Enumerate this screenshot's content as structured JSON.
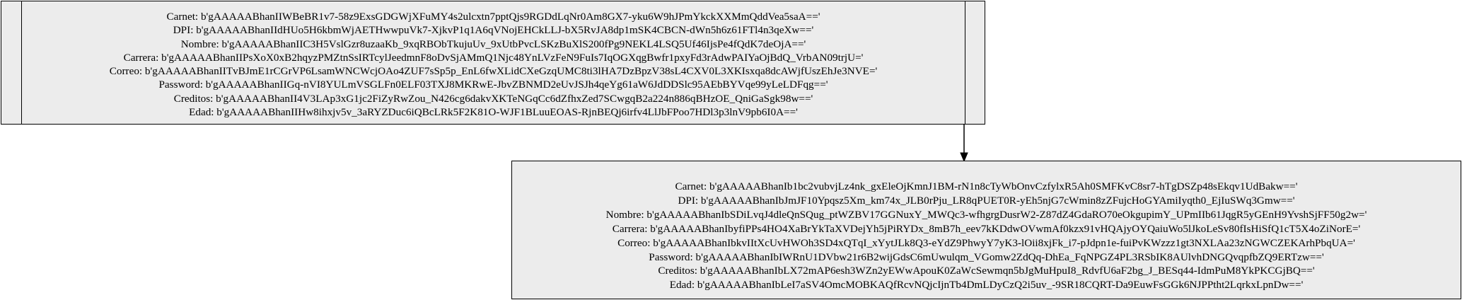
{
  "nodes": [
    {
      "fields": [
        "Carnet: b'gAAAAABhanIIWBeBR1v7-58z9ExsGDGWjXFuMY4s2ulcxtn7pptQjs9RGDdLqNr0Am8GX7-yku6W9hJPmYkckXXMmQddVea5saA=='",
        "DPI: b'gAAAAABhanIIdHUo5H6kbmWjAETHwwpuVk7-XjkvP1q1A6qVNojEHCkLLJ-bX5RvJA8dp1mSK4CBCN-dWn5h6z61FTl4n3qeXw=='",
        "Nombre: b'gAAAAABhanIIC3H5VslGzr8uzaaKb_9xqRBObTkujuUv_9xUtbPvcLSKzBuXlS200fPg9NEKL4LSQ5Uf46IjsPe4fQdK7deOjA=='",
        "Carrera: b'gAAAAABhanIIPsXoX0xB2hqyzPMZtnSsIRTcylJeedmnF8oDvSjAMmQ1Njc48YnLVzFeN9FuIs7IqOGXqgBwfr1pxyFd3rAdwPAIYaOjBdQ_VrbAN09trjU='",
        "Correo: b'gAAAAABhanIITvBJmE1rCGrVP6LsamWNCWcjOAo4ZUF7sSp5p_EnL6fwXLidCXeGzqUMC8ti3lHA7DzBpzV38sL4CXV0L3XKIsxqa8dcAWjfUszEhJe3NVE='",
        "Password: b'gAAAAABhanIIGq-nVI8YULmVSGLFn0ELF03TXJ8MKRwE-JbvZBNMD2eUvJSJh4qeYg61aW6JdDDSlc95AEbBYVqe99yLeLDFqg=='",
        "Creditos: b'gAAAAABhanII4V3LAp3xG1jc2FiZyRwZou_N426cg6dakvXKTeNGqCc6dZfhxZed7SCwgqB2a224n886qBHzOE_QniGaSgk98w=='",
        "Edad: b'gAAAAABhanIIHw8ihxjv5v_3aRYZDuc6iQBcLRk5F2K81O-WJF1BLuuEOAS-RjnBEQj6irfv4LlJbFPoo7HDl3p3lnV9pb6I0A=='"
      ]
    },
    {
      "fields": [
        "Carnet: b'gAAAAABhanIb1bc2vubvjLz4nk_gxEleOjKmnJ1BM-rN1n8cTyWbOnvCzfylxR5Ah0SMFKvC8sr7-hTgDSZp48sEkqv1UdBakw=='",
        "DPI: b'gAAAAABhanIbJmJF10Ypqsz5Xm_km74x_JLB0rPju_LR8qPUET0R-yEh5njG7cWmin8zZFujcHoGYAmiIyqth0_EjIuSWq3Gmw=='",
        "Nombre: b'gAAAAABhanIbSDiLvqJ4dleQnSQug_ptWZBV17GGNuxY_MWQc3-wfhgrgDusrW2-Z87dZ4GdaRO70eOkgupimY_UPmIIb61JqgR5yGEnH9YvshSjFF50g2w='",
        "Carrera: b'gAAAAABhanIbyfiPPs4HO4XaBrYkTaXVDejYh5jPiRYDx_8mB7h_eev7kKDdwOVwmAf0kzx91vHQAjyOYQaiuWo5lJkoLeSv80fIsHiSfQ1cT5X4oZiNorE='",
        "Correo: b'gAAAAABhanIbkvIItXcUvHWOh3SD4xQTqI_xYytJLk8Q3-eYdZ9PhwyY7yK3-lOii8xjFk_i7-pJdpn1e-fuiPvKWzzz1gt3NXLAa23zNGWCZEKArhPbqUA='",
        "Password: b'gAAAAABhanIbIWRnU1DVbw21r6B2wijGdsC6mUwulqm_VGomw2ZdQq-DhEa_FqNPGZ4PL3RSbIK8AUlvhDNGQvqpfbZQ9ERTzw=='",
        "Creditos: b'gAAAAABhanIbLX72mAP6esh3WZn2yEWwApouK0ZaWcSewmqn5bJgMuHpuI8_RdvfU6aF2bg_J_BESq44-IdmPuM8YkPKCGjBQ=='",
        "Edad: b'gAAAAABhanIbLeI7aSV4OmcMOBKAQfRcvNQjcIjnTb4DmLDyCzQ2i5uv_-9SR18CQRT-Da9EuwFsGGk6NJPPtht2LqrkxLpnDw=='"
      ]
    }
  ],
  "colors": {
    "node_fill": "#ececec",
    "stroke": "#000000",
    "background": "#ffffff"
  }
}
